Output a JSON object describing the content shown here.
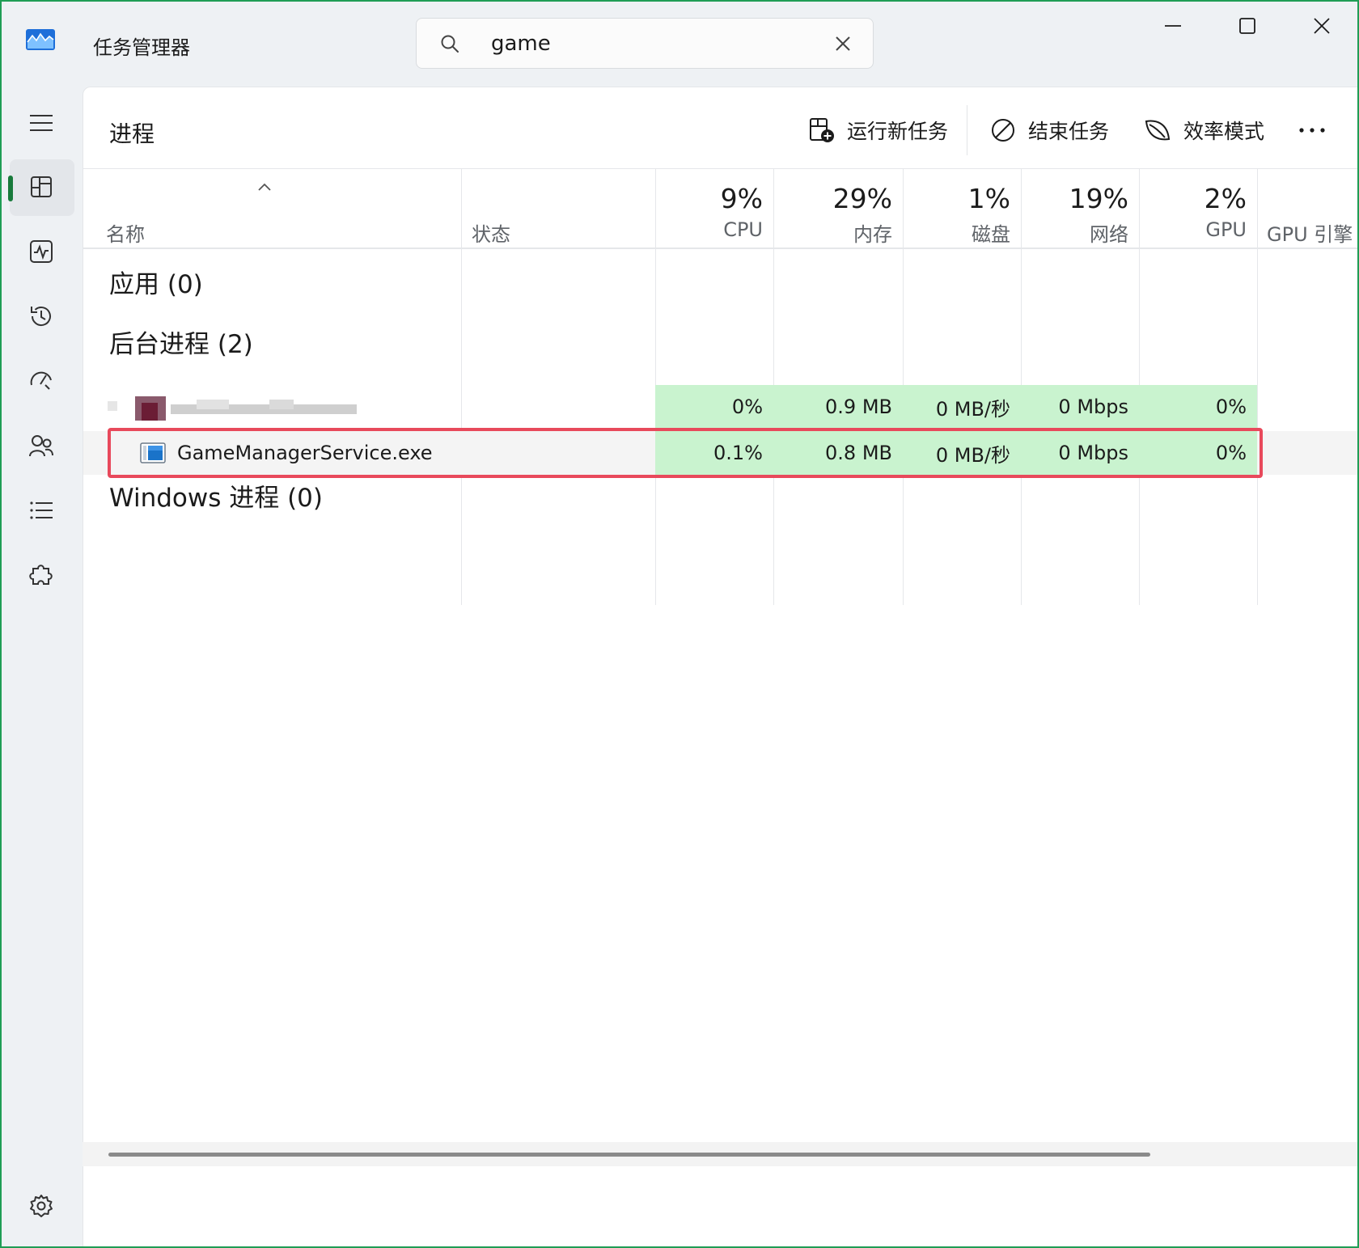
{
  "window": {
    "app_title": "任务管理器",
    "border_color": "#1f9d55",
    "controls": {
      "minimize_icon": "minimize-icon",
      "maximize_icon": "maximize-icon",
      "close_icon": "close-icon"
    }
  },
  "search": {
    "value": "game",
    "placeholder": "",
    "icon": "search-icon",
    "clear_icon": "close-icon"
  },
  "sidebar": {
    "items": [
      {
        "name": "hamburger-menu",
        "icon": "hamburger-icon"
      },
      {
        "name": "processes",
        "icon": "processes-icon",
        "active": true
      },
      {
        "name": "performance",
        "icon": "pulse-icon"
      },
      {
        "name": "app-history",
        "icon": "history-icon"
      },
      {
        "name": "startup-apps",
        "icon": "speedometer-icon"
      },
      {
        "name": "users",
        "icon": "users-icon"
      },
      {
        "name": "details",
        "icon": "list-icon"
      },
      {
        "name": "services",
        "icon": "puzzle-icon"
      },
      {
        "name": "settings",
        "icon": "gear-icon"
      }
    ],
    "accent": "#187a3b"
  },
  "main": {
    "page_title": "进程",
    "toolbar": {
      "run_new_task": "运行新任务",
      "end_task": "结束任务",
      "efficiency_mode": "效率模式",
      "more": "..."
    }
  },
  "table": {
    "sort_indicator": "^",
    "columns": {
      "name": "名称",
      "status": "状态",
      "cpu": {
        "percent": "9%",
        "label": "CPU"
      },
      "memory": {
        "percent": "29%",
        "label": "内存"
      },
      "disk": {
        "percent": "1%",
        "label": "磁盘"
      },
      "network": {
        "percent": "19%",
        "label": "网络"
      },
      "gpu": {
        "percent": "2%",
        "label": "GPU"
      },
      "gpu_engine": {
        "label": "GPU 引擎"
      }
    },
    "groups": {
      "apps": "应用 (0)",
      "background": "后台进程 (2)",
      "windows": "Windows 进程 (0)"
    },
    "rows": [
      {
        "name": "",
        "blurred": true,
        "cpu": "0%",
        "memory": "0.9 MB",
        "disk": "0 MB/秒",
        "network": "0 Mbps",
        "gpu": "0%"
      },
      {
        "name": "GameManagerService.exe",
        "blurred": false,
        "cpu": "0.1%",
        "memory": "0.8 MB",
        "disk": "0 MB/秒",
        "network": "0 Mbps",
        "gpu": "0%",
        "selected": true,
        "highlighted": true
      }
    ],
    "heat_color": "#c9f3cf",
    "highlight_color": "#e8495b"
  }
}
